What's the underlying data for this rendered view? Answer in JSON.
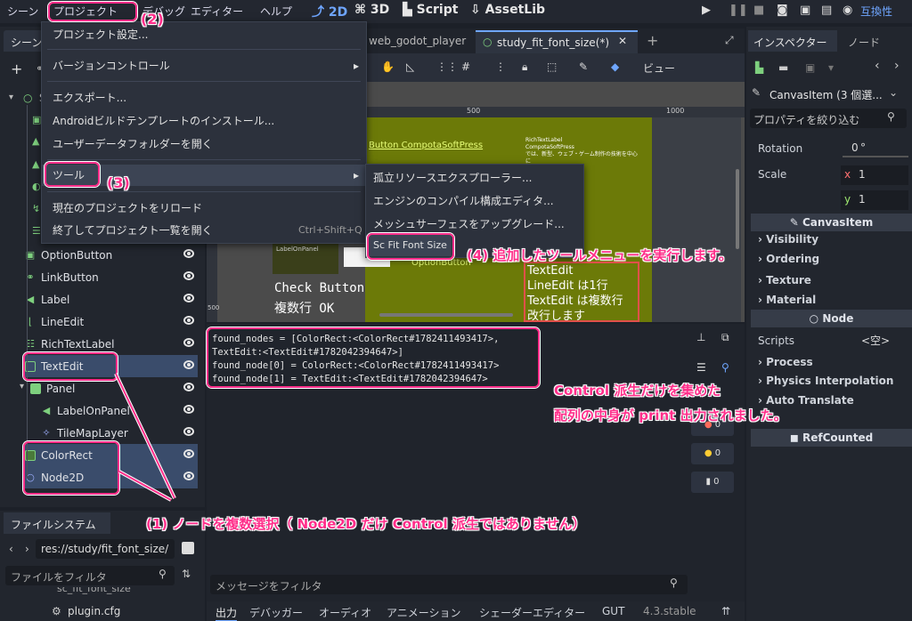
{
  "menubar": {
    "scene": "シーン",
    "project": "プロジェクト",
    "debug": "デバッグ",
    "editor": "エディター",
    "help": "ヘルプ",
    "mode_2d": "2D",
    "mode_3d": "3D",
    "mode_script": "Script",
    "mode_assetlib": "AssetLib",
    "compat": "互換性"
  },
  "scene_tab": {
    "title": "シーン",
    "root_label": "St"
  },
  "scene_tabs": {
    "tab1": "web_godot_player",
    "tab2": "study_fit_font_size(*)"
  },
  "toolbar": {
    "view": "ビュー"
  },
  "ruler": {
    "m500": "500",
    "m1000": "1000"
  },
  "project_menu": {
    "items": [
      "プロジェクト設定...",
      "バージョンコントロール",
      "エクスポート...",
      "Androidビルドテンプレートのインストール...",
      "ユーザーデータフォルダーを開く",
      "ツール",
      "現在のプロジェクトをリロード",
      "終了してプロジェクト一覧を開く"
    ],
    "shortcut": "Ctrl+Shift+Q"
  },
  "tools_submenu": {
    "items": [
      "孤立リソースエクスプローラー...",
      "エンジンのコンパイル構成エディタ...",
      "メッシュサーフェスをアップグレード...",
      "Sc Fit Font Size"
    ]
  },
  "tree": {
    "nodes": [
      "OptionButton",
      "LinkButton",
      "Label",
      "LineEdit",
      "RichTextLabel",
      "TextEdit",
      "Panel",
      "LabelOnPanel",
      "TileMapLayer",
      "ColorRect",
      "Node2D"
    ]
  },
  "canvas": {
    "button_text": "Button CompotaSoftPress",
    "rich_title": "RichTextLabel",
    "rich_line1": "CompotaSoftPress",
    "rich_line2": "では、新型、ウェブ・ゲーム制作の技術を中心に",
    "label_on_panel": "LabelOnPanel",
    "option_text": "OptionButton",
    "check_button": "Check Button",
    "multiline": "複数行 OK",
    "textedit_l1": "TextEdit",
    "textedit_l2": "LineEdit は1行",
    "textedit_l3": "TextEdit は複数行",
    "textedit_l4": "改行します",
    "side_ruler": "500"
  },
  "output": {
    "line1": "found_nodes = [ColorRect:<ColorRect#1782411493417>,",
    "line2": "TextEdit:<TextEdit#1782042394647>]",
    "line3": "found_node[0] = ColorRect:<ColorRect#1782411493417>",
    "line4": "found_node[1] = TextEdit:<TextEdit#1782042394647>",
    "filter_placeholder": "メッセージをフィルタ"
  },
  "output_counts": {
    "c1": "0",
    "c2": "0",
    "c3": "0"
  },
  "bottom_tabs": [
    "出力",
    "デバッガー",
    "オーディオ",
    "アニメーション",
    "シェーダーエディター",
    "GUT"
  ],
  "version": "4.3.stable",
  "filesystem": {
    "title": "ファイルシステム",
    "path": "res://study/fit_font_size/",
    "filter": "ファイルをフィルタ",
    "item1": "sc_fit_font_size",
    "item2": "plugin.cfg"
  },
  "inspector": {
    "tab1": "インスペクター",
    "tab2": "ノード",
    "object": "CanvasItem (3 個選...",
    "filter": "プロパティを絞り込む",
    "rotation_label": "Rotation",
    "rotation_val": "0",
    "rotation_unit": "°",
    "scale_label": "Scale",
    "scale_x": "x",
    "scale_x_val": "1",
    "scale_y": "y",
    "scale_y_val": "1",
    "canvasitem": "CanvasItem",
    "visibility": "Visibility",
    "ordering": "Ordering",
    "texture": "Texture",
    "material": "Material",
    "node": "Node",
    "scripts_label": "Scripts",
    "scripts_val": "<空>",
    "process": "Process",
    "physics": "Physics Interpolation",
    "autotranslate": "Auto Translate",
    "refcounted": "RefCounted"
  },
  "annotations": {
    "a1": "(1) ノードを複数選択（ Node2D だけ Control 派生ではありません）",
    "a2": "(2)",
    "a3": "(3)",
    "a4": "(4) 追加したツールメニューを実行します。",
    "a5_l1": "Control 派生だけを集めた",
    "a5_l2": "配列の中身が print 出力されました。"
  }
}
